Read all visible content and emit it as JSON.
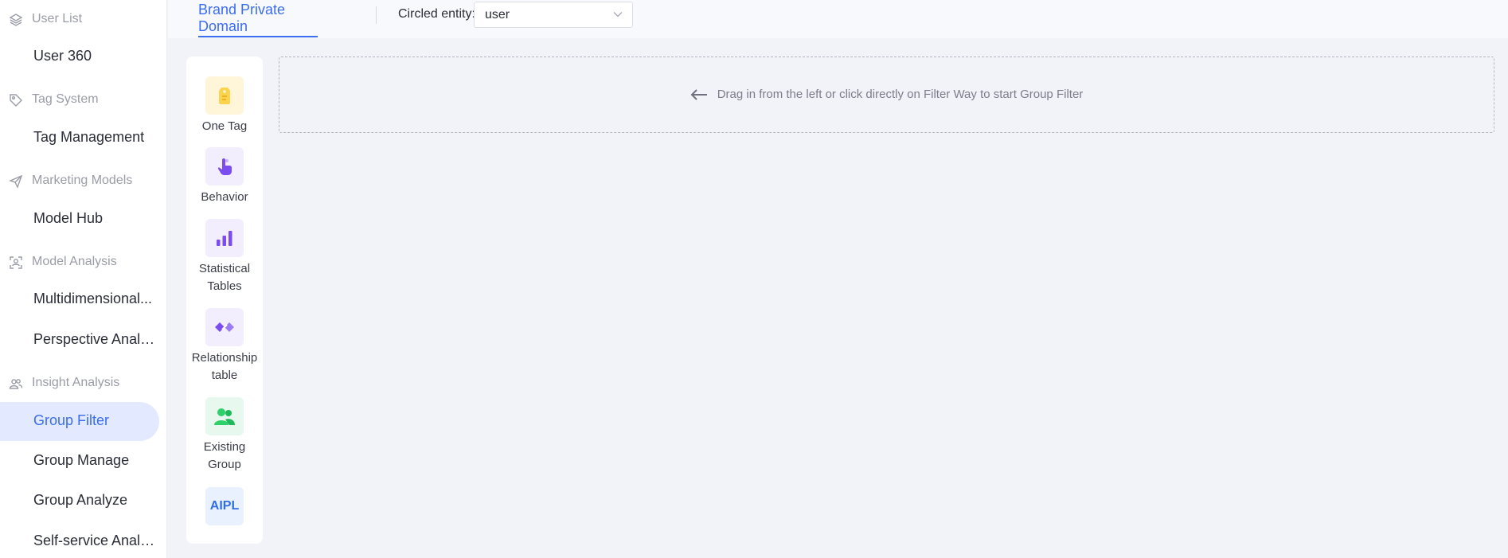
{
  "sidebar": {
    "groups": [
      {
        "title": "User List",
        "icon": "layers-icon",
        "items": [
          {
            "label": "User 360"
          }
        ]
      },
      {
        "title": "Tag System",
        "icon": "tag-icon",
        "items": [
          {
            "label": "Tag Management"
          }
        ]
      },
      {
        "title": "Marketing Models",
        "icon": "send-icon",
        "items": [
          {
            "label": "Model Hub"
          }
        ]
      },
      {
        "title": "Model Analysis",
        "icon": "user-scan-icon",
        "items": [
          {
            "label": "Multidimensional..."
          },
          {
            "label": "Perspective Analy..."
          }
        ]
      },
      {
        "title": "Insight Analysis",
        "icon": "users-icon",
        "items": [
          {
            "label": "Group Filter",
            "active": true
          },
          {
            "label": "Group Manage"
          },
          {
            "label": "Group Analyze"
          },
          {
            "label": "Self-service Analy..."
          }
        ]
      }
    ]
  },
  "topbar": {
    "tab": "Brand Private Domain",
    "entity_label": "Circled entity:",
    "entity_value": "user"
  },
  "filter_ways": [
    {
      "label": "One Tag",
      "icon": "tag-icon",
      "color": "#fbd34d",
      "bg": "#fff5d9"
    },
    {
      "label": "Behavior",
      "icon": "hand-pointer-icon",
      "color": "#7b4cf0",
      "bg": "#f3eefe"
    },
    {
      "label": "Statistical Tables",
      "icon": "bar-chart-icon",
      "color": "#7b4cf0",
      "bg": "#f3eefe"
    },
    {
      "label": "Relationship table",
      "icon": "relationship-icon",
      "color": "#7b4cf0",
      "bg": "#f3eefe"
    },
    {
      "label": "Existing Group",
      "icon": "group-icon",
      "color": "#2fcf6a",
      "bg": "#e7f8ee"
    },
    {
      "label": "AIPL",
      "icon": "aipl-icon",
      "color": "#2f6ee8",
      "bg": "#e8f1fd"
    }
  ],
  "dropzone": {
    "hint": "Drag in from the left or click directly on Filter Way to start Group Filter"
  },
  "colors": {
    "accent": "#3a6df0",
    "active_bg": "#e3eaff",
    "page_bg": "#f2f3f8"
  }
}
